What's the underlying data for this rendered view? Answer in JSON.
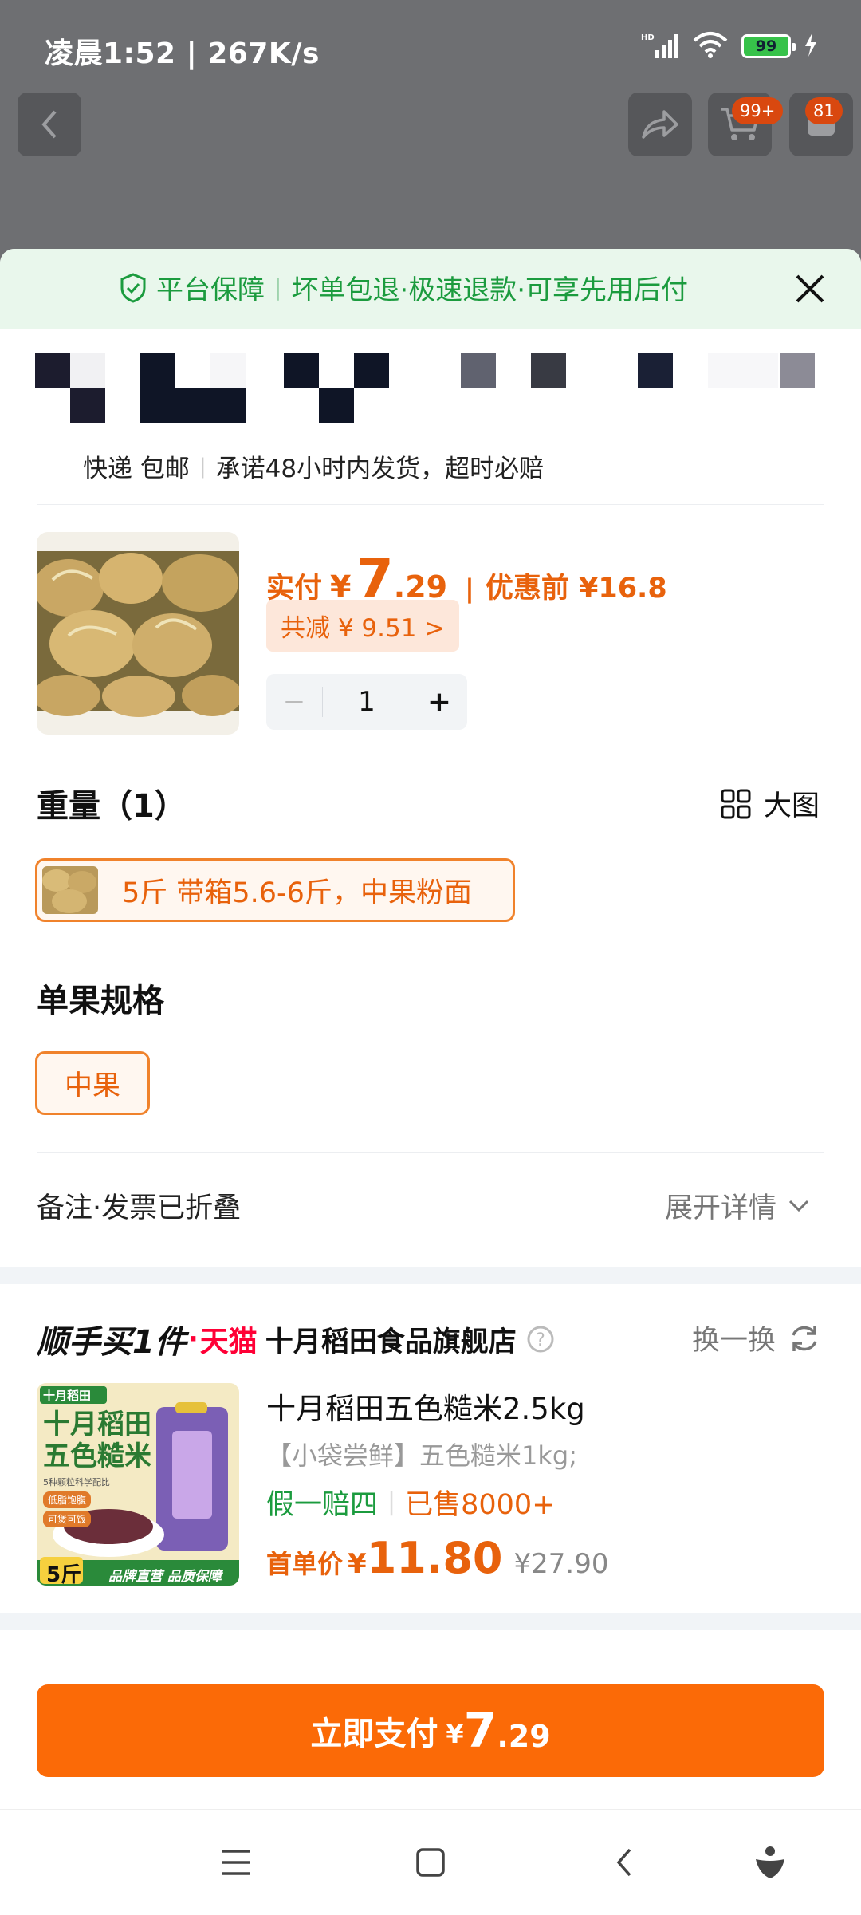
{
  "status_bar": {
    "time": "凌晨1:52 | 267K/s",
    "battery": "99"
  },
  "top_nav": {
    "cart_badge": "99+",
    "message_badge": "81"
  },
  "guarantee": {
    "label": "平台保障",
    "separator": "|",
    "items": "坏单包退·极速退款·可享先用后付"
  },
  "delivery": {
    "method": "快递 包邮",
    "promise": "承诺48小时内发货，超时必赔"
  },
  "price": {
    "paid_label": "实付",
    "currency": "¥",
    "integer": "7",
    "decimal": ".29",
    "separator": "|",
    "before_label": "优惠前 ¥16.8",
    "discount": "共减 ¥ 9.51 >"
  },
  "stepper": {
    "minus": "−",
    "qty": "1",
    "plus": "+"
  },
  "weight": {
    "title": "重量（1）",
    "big_image": "大图",
    "option": "5斤 带箱5.6-6斤，中果粉面"
  },
  "size": {
    "title": "单果规格",
    "option": "中果"
  },
  "notes": {
    "label": "备注·发票已折叠",
    "expand": "展开详情"
  },
  "upsell": {
    "brand": "顺手买1件",
    "dot": "·",
    "tmall": "天猫",
    "store": "十月稻田食品旗舰店",
    "swap": "换一换",
    "product_title": "十月稻田五色糙米2.5kg",
    "product_sub": "【小袋尝鲜】五色糙米1kg;",
    "tag1": "假一赔四",
    "tag_sep": "|",
    "sold": "已售8000+",
    "first_price_label": "首单价",
    "first_currency": "¥",
    "first_price": "11.80",
    "orig_price": "¥27.90",
    "img_brand": "十月稻田",
    "img_title1": "十月稻田",
    "img_title2": "五色糙米",
    "img_small": "5种颗粒科学配比",
    "img_tag1": "低脂饱腹",
    "img_tag2": "可煲可饭",
    "img_weight": "5斤",
    "img_footer": "品牌直营 品质保障"
  },
  "pay_button": {
    "label": "立即支付",
    "currency": "¥",
    "integer": "7",
    "decimal": ".29"
  },
  "colors": {
    "accent": "#fb6a07",
    "price": "#e8620c",
    "green": "#1b9b3e",
    "tmall_red": "#ff0036"
  }
}
